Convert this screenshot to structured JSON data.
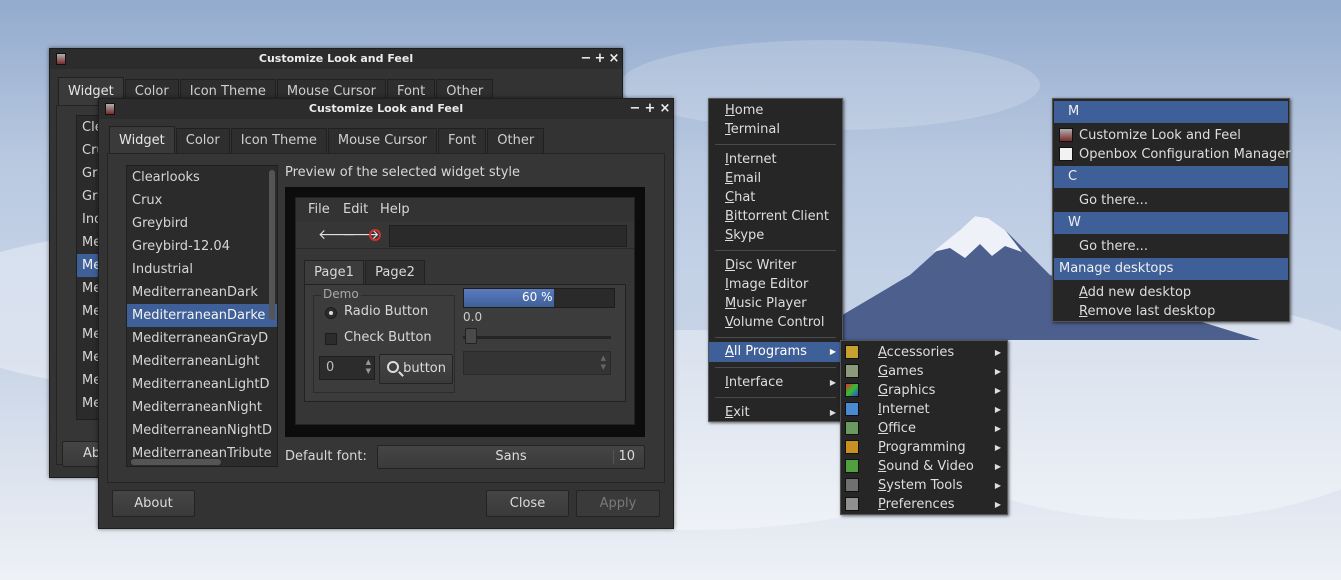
{
  "back_window": {
    "title": "Customize Look and Feel",
    "tabs": [
      "Widget",
      "Color",
      "Icon Theme",
      "Mouse Cursor",
      "Font",
      "Other"
    ],
    "list_items": [
      "Cle",
      "Cru",
      "Gre",
      "Gre",
      "Ind",
      "Me",
      "Me",
      "Me",
      "Me",
      "Me",
      "Me",
      "Me",
      "Me"
    ],
    "about_label": "Ab"
  },
  "front_window": {
    "title": "Customize Look and Feel",
    "tabs": [
      "Widget",
      "Color",
      "Icon Theme",
      "Mouse Cursor",
      "Font",
      "Other"
    ],
    "themes": [
      "Clearlooks",
      "Crux",
      "Greybird",
      "Greybird-12.04",
      "Industrial",
      "MediterraneanDark",
      "MediterraneanDarke",
      "MediterraneanGrayD",
      "MediterraneanLight",
      "MediterraneanLightD",
      "MediterraneanNight",
      "MediterraneanNightD",
      "MediterraneanTribute"
    ],
    "selected_theme_index": 6,
    "preview_label": "Preview of the selected widget style",
    "preview": {
      "menu": [
        "File",
        "Edit",
        "Help"
      ],
      "tabs": [
        "Page1",
        "Page2"
      ],
      "frame_label": "Demo",
      "radio_label": "Radio Button",
      "check_label": "Check Button",
      "spin_value": "0",
      "button_label": "button",
      "progress_text": "60 %",
      "progress_value": 0.6,
      "scale_value": "0.0"
    },
    "default_font_label": "Default font:",
    "font_name": "Sans",
    "font_size": "10",
    "about_label": "About",
    "close_label": "Close",
    "apply_label": "Apply"
  },
  "root_menu": {
    "items": [
      {
        "label": "Home",
        "ul": "H"
      },
      {
        "label": "Terminal",
        "ul": "T"
      },
      {
        "label": "Internet",
        "ul": "I"
      },
      {
        "label": "Email",
        "ul": "E"
      },
      {
        "label": "Chat",
        "ul": "C"
      },
      {
        "label": "Bittorrent Client",
        "ul": "B"
      },
      {
        "label": "Skype",
        "ul": "S"
      },
      {
        "label": "Disc Writer",
        "ul": "D"
      },
      {
        "label": "Image Editor",
        "ul": "I"
      },
      {
        "label": "Music Player",
        "ul": "M"
      },
      {
        "label": "Volume Control",
        "ul": "V"
      },
      {
        "label": "All Programs",
        "ul": "A"
      },
      {
        "label": "Interface",
        "ul": "I"
      },
      {
        "label": "Exit",
        "ul": "E"
      }
    ]
  },
  "programs_menu": {
    "items": [
      {
        "label": "Accessories",
        "color": "#c8a030"
      },
      {
        "label": "Games",
        "color": "#8a9a7a"
      },
      {
        "label": "Graphics",
        "color": "#c04060"
      },
      {
        "label": "Internet",
        "color": "#4a8ad0"
      },
      {
        "label": "Office",
        "color": "#6a9a60"
      },
      {
        "label": "Programming",
        "color": "#c89020"
      },
      {
        "label": "Sound & Video",
        "color": "#50a040"
      },
      {
        "label": "System Tools",
        "color": "#707070"
      },
      {
        "label": "Preferences",
        "color": "#909090"
      }
    ]
  },
  "desktop_menu": {
    "sections": [
      {
        "header": "M",
        "items": [
          "Customize Look and Feel",
          "Openbox Configuration Manager"
        ]
      },
      {
        "header": "C",
        "items": [
          "Go there..."
        ]
      },
      {
        "header": "W",
        "items": [
          "Go there..."
        ]
      },
      {
        "header": "Manage desktops",
        "items": [
          "Add new desktop",
          "Remove last desktop"
        ]
      }
    ]
  },
  "colors": {
    "accent": "#3e5f97",
    "window_bg": "#333333",
    "menu_bg": "#262626"
  }
}
